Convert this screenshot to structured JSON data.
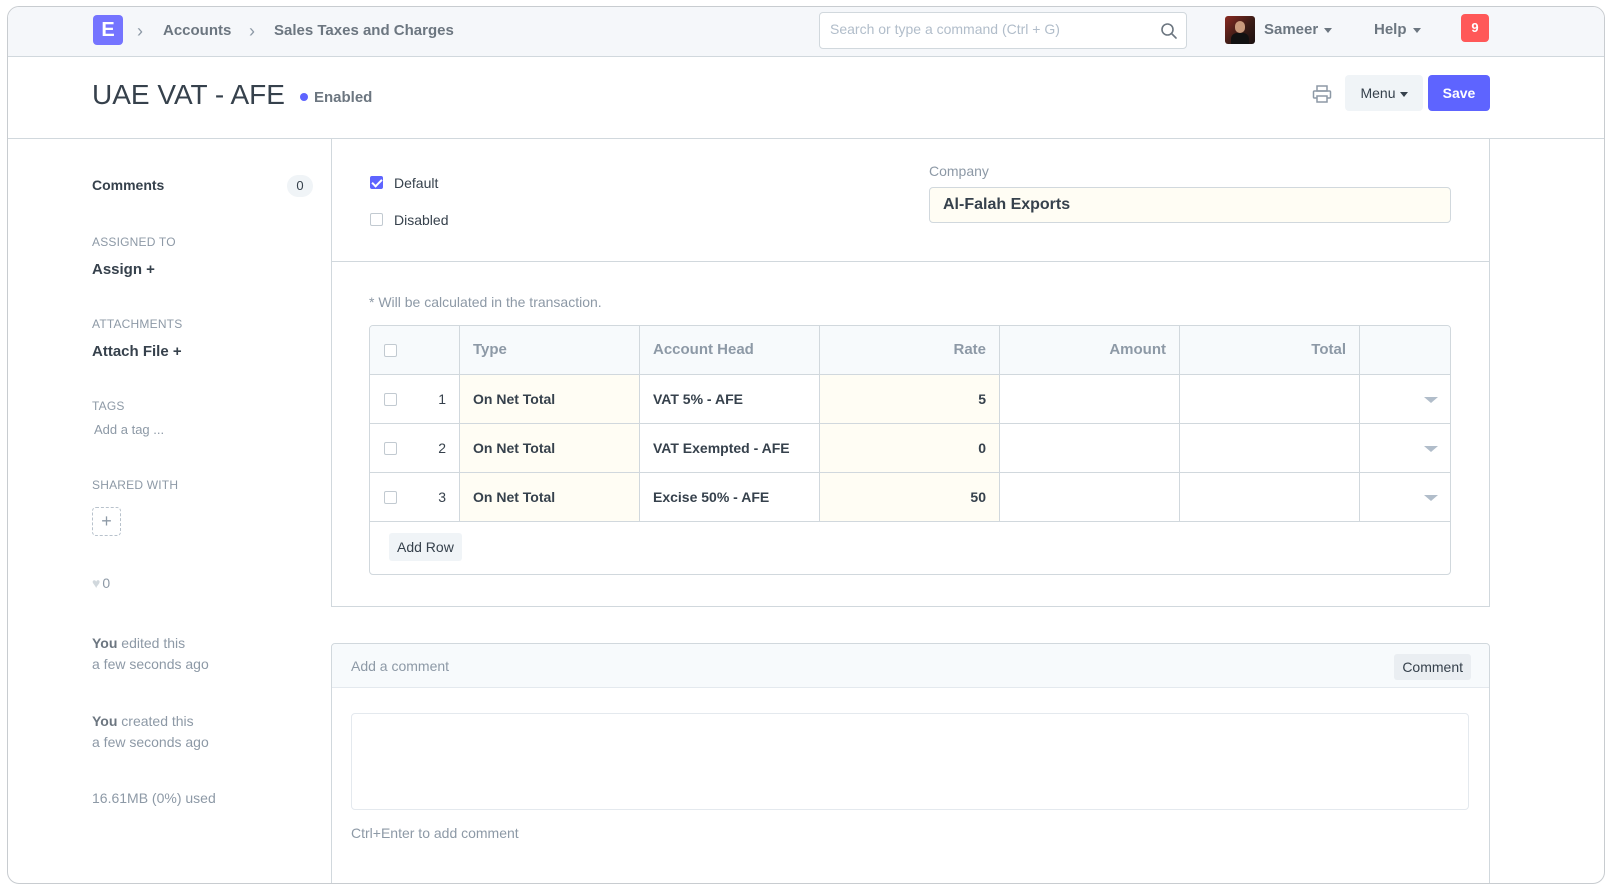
{
  "navbar": {
    "logo": "E",
    "breadcrumbs": [
      "Accounts",
      "Sales Taxes and Charges"
    ],
    "search_placeholder": "Search or type a command (Ctrl + G)",
    "user": "Sameer",
    "help": "Help",
    "notifications": "9"
  },
  "page": {
    "title": "UAE VAT - AFE",
    "status": "Enabled",
    "status_color": "#5e64ff",
    "menu_label": "Menu",
    "save_label": "Save"
  },
  "sidebar": {
    "comments_label": "Comments",
    "comments_count": "0",
    "assigned_label": "ASSIGNED TO",
    "assign_action": "Assign +",
    "attachments_label": "ATTACHMENTS",
    "attach_action": "Attach File +",
    "tags_label": "TAGS",
    "tag_placeholder": "Add a tag ...",
    "shared_label": "SHARED WITH",
    "shared_add": "+",
    "likes": "0",
    "events": [
      {
        "who": "You",
        "action": " edited this",
        "when": "a few seconds ago"
      },
      {
        "who": "You",
        "action": " created this",
        "when": "a few seconds ago"
      }
    ],
    "usage": "16.61MB (0%) used"
  },
  "form": {
    "default_label": "Default",
    "default_checked": true,
    "disabled_label": "Disabled",
    "disabled_checked": false,
    "company_label": "Company",
    "company_value": "Al-Falah Exports",
    "note": "* Will be calculated in the transaction.",
    "grid": {
      "columns": [
        "Type",
        "Account Head",
        "Rate",
        "Amount",
        "Total"
      ],
      "rows": [
        {
          "no": "1",
          "type": "On Net Total",
          "account_head": "VAT 5% - AFE",
          "rate": "5",
          "amount": "",
          "total": ""
        },
        {
          "no": "2",
          "type": "On Net Total",
          "account_head": "VAT Exempted - AFE",
          "rate": "0",
          "amount": "",
          "total": ""
        },
        {
          "no": "3",
          "type": "On Net Total",
          "account_head": "Excise 50% - AFE",
          "rate": "50",
          "amount": "",
          "total": ""
        }
      ],
      "add_row_label": "Add Row"
    }
  },
  "comment": {
    "header": "Add a comment",
    "button": "Comment",
    "hint": "Ctrl+Enter to add comment"
  }
}
